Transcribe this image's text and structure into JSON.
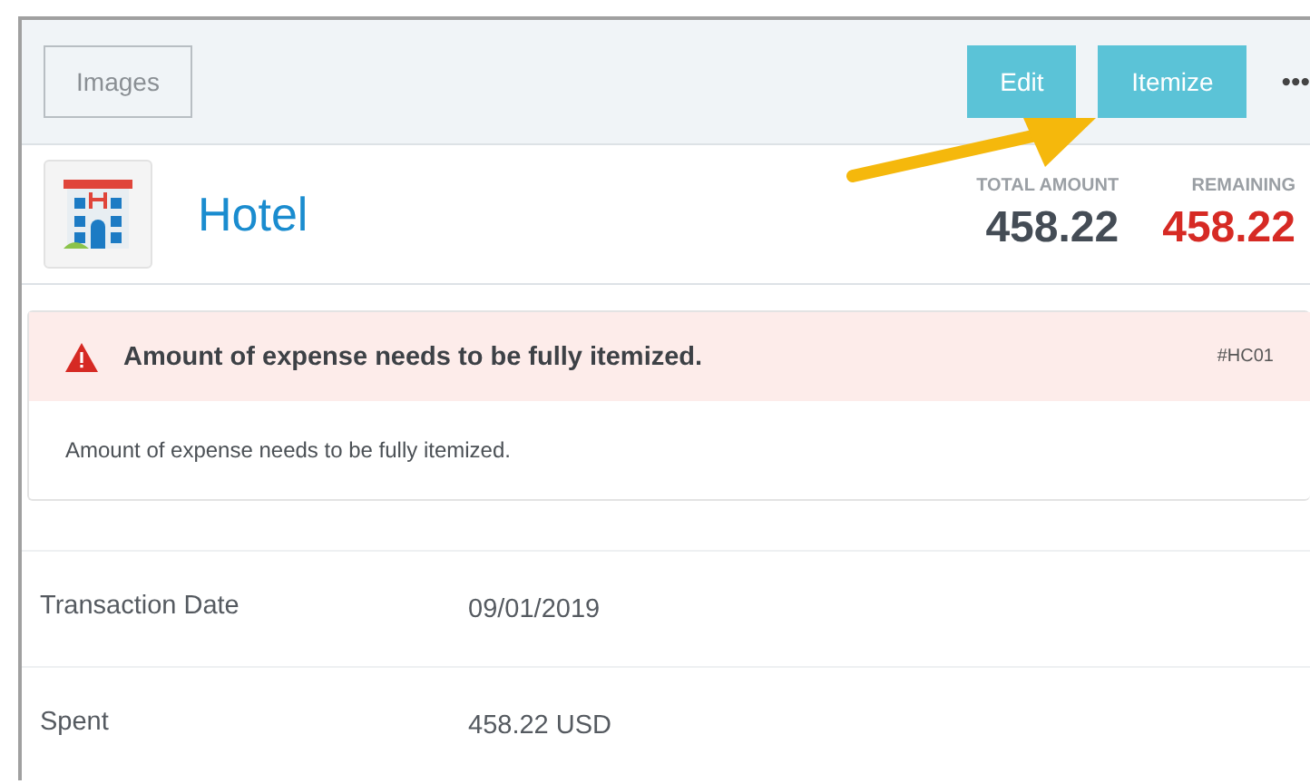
{
  "toolbar": {
    "buttons": [
      {
        "label": "Images",
        "kind": "outline"
      },
      {
        "label": "Edit",
        "kind": "primary"
      },
      {
        "label": "Itemize",
        "kind": "primary"
      }
    ],
    "more": "•••"
  },
  "expense": {
    "type": "Hotel",
    "total_label": "TOTAL AMOUNT",
    "total": "458.22",
    "remaining_label": "REMAINING",
    "remaining": "458.22"
  },
  "alert": {
    "title": "Amount of expense needs to be fully itemized.",
    "code": "#HC01",
    "message": "Amount of expense needs to be fully itemized."
  },
  "fields": [
    {
      "label": "Transaction Date",
      "value": "09/01/2019"
    },
    {
      "label": "Spent",
      "value": "458.22 USD"
    }
  ]
}
